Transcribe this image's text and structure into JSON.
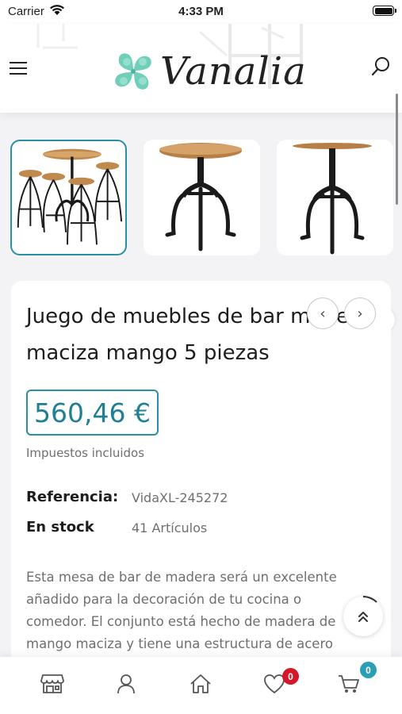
{
  "status_bar": {
    "carrier": "Carrier",
    "time": "4:33 PM"
  },
  "header": {
    "logo_text": "Vanalia"
  },
  "gallery": {
    "thumbnails": [
      "bar set with 4 stools",
      "round bar table",
      "round bar table side view"
    ],
    "active_index": 0
  },
  "product": {
    "title": "Juego de muebles de bar madera maciza mango 5 piezas",
    "price": "560,46 €",
    "taxes_note": "Impuestos incluidos",
    "reference_label": "Referencia:",
    "reference_value": "VidaXL-245272",
    "stock_label": "En stock",
    "stock_value": "41 Artículos",
    "description": "Esta mesa de bar de madera será un excelente añadido para la decoración de tu cocina o comedor. El conjunto está hecho de madera de mango maciza y tiene una estructura de acero"
  },
  "bottom_nav": {
    "items": [
      "store-icon",
      "user-icon",
      "home-icon",
      "heart-icon",
      "cart-icon"
    ],
    "wishlist_count": "0",
    "cart_count": "0"
  },
  "colors": {
    "accent": "#2a8fa0",
    "price": "#1f7f93",
    "wishlist_badge": "#d6172a",
    "cart_badge": "#2a9fb4"
  }
}
